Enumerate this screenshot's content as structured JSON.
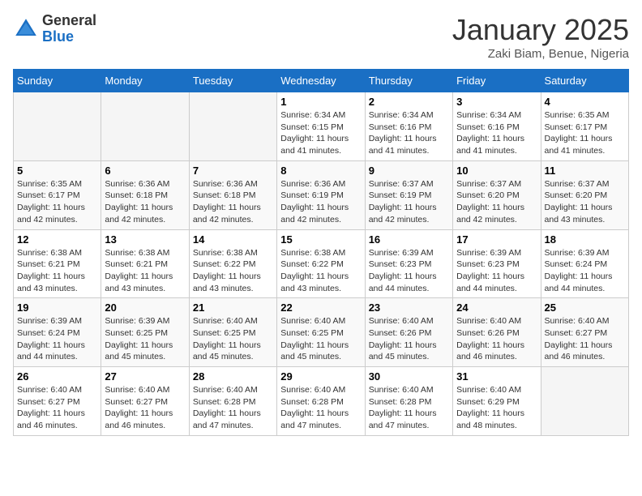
{
  "header": {
    "logo_general": "General",
    "logo_blue": "Blue",
    "month_title": "January 2025",
    "subtitle": "Zaki Biam, Benue, Nigeria"
  },
  "weekdays": [
    "Sunday",
    "Monday",
    "Tuesday",
    "Wednesday",
    "Thursday",
    "Friday",
    "Saturday"
  ],
  "weeks": [
    [
      {
        "day": "",
        "empty": true
      },
      {
        "day": "",
        "empty": true
      },
      {
        "day": "",
        "empty": true
      },
      {
        "day": "1",
        "sunrise": "6:34 AM",
        "sunset": "6:15 PM",
        "daylight": "11 hours and 41 minutes."
      },
      {
        "day": "2",
        "sunrise": "6:34 AM",
        "sunset": "6:16 PM",
        "daylight": "11 hours and 41 minutes."
      },
      {
        "day": "3",
        "sunrise": "6:34 AM",
        "sunset": "6:16 PM",
        "daylight": "11 hours and 41 minutes."
      },
      {
        "day": "4",
        "sunrise": "6:35 AM",
        "sunset": "6:17 PM",
        "daylight": "11 hours and 41 minutes."
      }
    ],
    [
      {
        "day": "5",
        "sunrise": "6:35 AM",
        "sunset": "6:17 PM",
        "daylight": "11 hours and 42 minutes."
      },
      {
        "day": "6",
        "sunrise": "6:36 AM",
        "sunset": "6:18 PM",
        "daylight": "11 hours and 42 minutes."
      },
      {
        "day": "7",
        "sunrise": "6:36 AM",
        "sunset": "6:18 PM",
        "daylight": "11 hours and 42 minutes."
      },
      {
        "day": "8",
        "sunrise": "6:36 AM",
        "sunset": "6:19 PM",
        "daylight": "11 hours and 42 minutes."
      },
      {
        "day": "9",
        "sunrise": "6:37 AM",
        "sunset": "6:19 PM",
        "daylight": "11 hours and 42 minutes."
      },
      {
        "day": "10",
        "sunrise": "6:37 AM",
        "sunset": "6:20 PM",
        "daylight": "11 hours and 42 minutes."
      },
      {
        "day": "11",
        "sunrise": "6:37 AM",
        "sunset": "6:20 PM",
        "daylight": "11 hours and 43 minutes."
      }
    ],
    [
      {
        "day": "12",
        "sunrise": "6:38 AM",
        "sunset": "6:21 PM",
        "daylight": "11 hours and 43 minutes."
      },
      {
        "day": "13",
        "sunrise": "6:38 AM",
        "sunset": "6:21 PM",
        "daylight": "11 hours and 43 minutes."
      },
      {
        "day": "14",
        "sunrise": "6:38 AM",
        "sunset": "6:22 PM",
        "daylight": "11 hours and 43 minutes."
      },
      {
        "day": "15",
        "sunrise": "6:38 AM",
        "sunset": "6:22 PM",
        "daylight": "11 hours and 43 minutes."
      },
      {
        "day": "16",
        "sunrise": "6:39 AM",
        "sunset": "6:23 PM",
        "daylight": "11 hours and 44 minutes."
      },
      {
        "day": "17",
        "sunrise": "6:39 AM",
        "sunset": "6:23 PM",
        "daylight": "11 hours and 44 minutes."
      },
      {
        "day": "18",
        "sunrise": "6:39 AM",
        "sunset": "6:24 PM",
        "daylight": "11 hours and 44 minutes."
      }
    ],
    [
      {
        "day": "19",
        "sunrise": "6:39 AM",
        "sunset": "6:24 PM",
        "daylight": "11 hours and 44 minutes."
      },
      {
        "day": "20",
        "sunrise": "6:39 AM",
        "sunset": "6:25 PM",
        "daylight": "11 hours and 45 minutes."
      },
      {
        "day": "21",
        "sunrise": "6:40 AM",
        "sunset": "6:25 PM",
        "daylight": "11 hours and 45 minutes."
      },
      {
        "day": "22",
        "sunrise": "6:40 AM",
        "sunset": "6:25 PM",
        "daylight": "11 hours and 45 minutes."
      },
      {
        "day": "23",
        "sunrise": "6:40 AM",
        "sunset": "6:26 PM",
        "daylight": "11 hours and 45 minutes."
      },
      {
        "day": "24",
        "sunrise": "6:40 AM",
        "sunset": "6:26 PM",
        "daylight": "11 hours and 46 minutes."
      },
      {
        "day": "25",
        "sunrise": "6:40 AM",
        "sunset": "6:27 PM",
        "daylight": "11 hours and 46 minutes."
      }
    ],
    [
      {
        "day": "26",
        "sunrise": "6:40 AM",
        "sunset": "6:27 PM",
        "daylight": "11 hours and 46 minutes."
      },
      {
        "day": "27",
        "sunrise": "6:40 AM",
        "sunset": "6:27 PM",
        "daylight": "11 hours and 46 minutes."
      },
      {
        "day": "28",
        "sunrise": "6:40 AM",
        "sunset": "6:28 PM",
        "daylight": "11 hours and 47 minutes."
      },
      {
        "day": "29",
        "sunrise": "6:40 AM",
        "sunset": "6:28 PM",
        "daylight": "11 hours and 47 minutes."
      },
      {
        "day": "30",
        "sunrise": "6:40 AM",
        "sunset": "6:28 PM",
        "daylight": "11 hours and 47 minutes."
      },
      {
        "day": "31",
        "sunrise": "6:40 AM",
        "sunset": "6:29 PM",
        "daylight": "11 hours and 48 minutes."
      },
      {
        "day": "",
        "empty": true
      }
    ]
  ]
}
